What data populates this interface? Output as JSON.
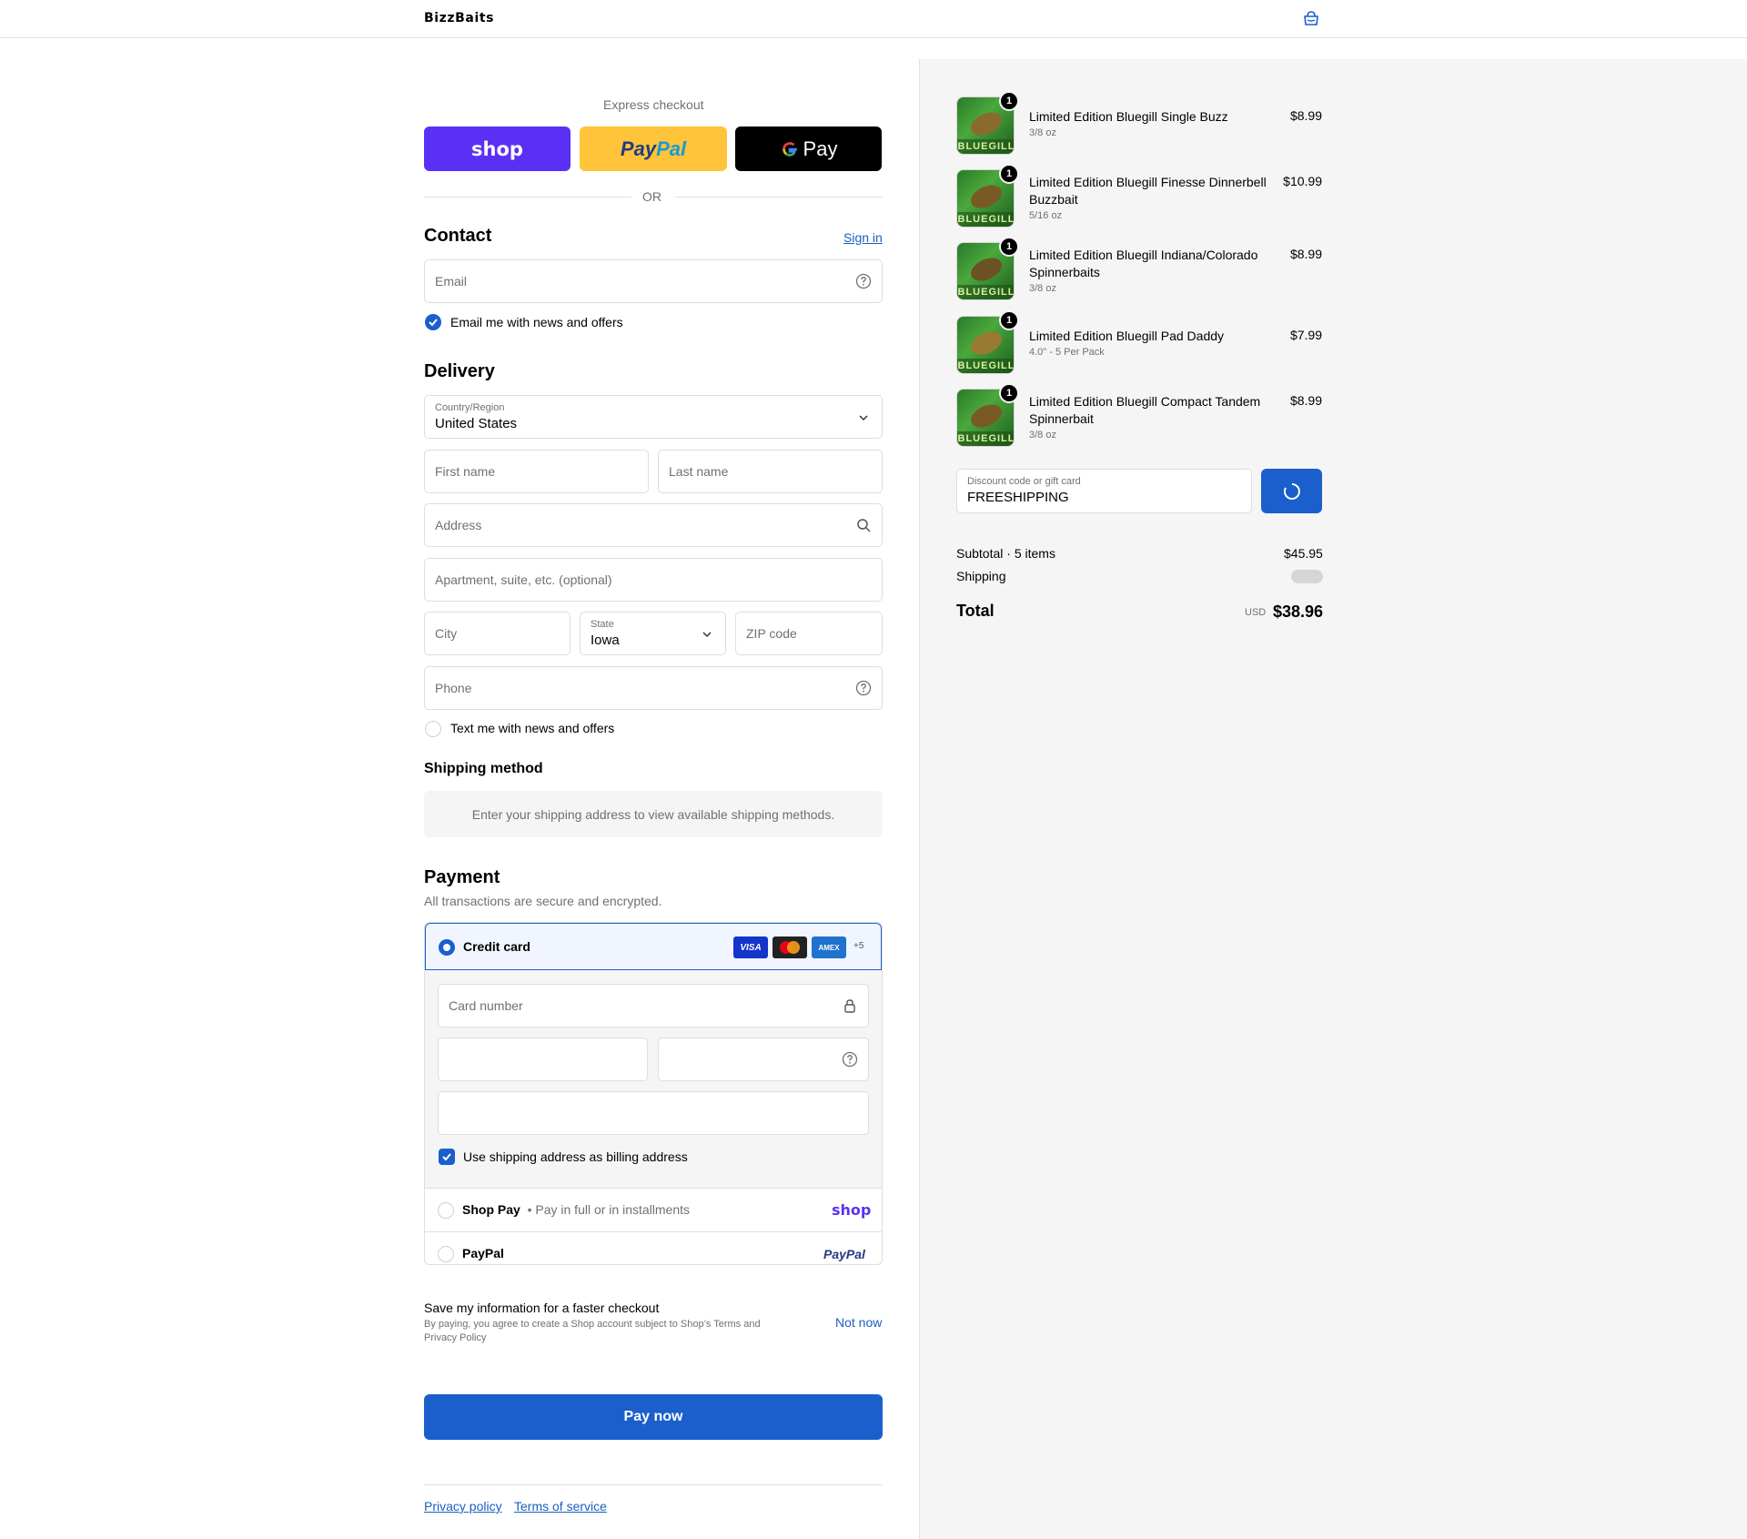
{
  "header": {
    "brand": "BizzBaits"
  },
  "express": {
    "label": "Express checkout",
    "shop_label": "shop",
    "paypal_pay": "Pay",
    "paypal_pal": "Pal",
    "gpay_label": "Pay",
    "or_label": "OR"
  },
  "contact": {
    "title": "Contact",
    "sign_in": "Sign in",
    "email_placeholder": "Email",
    "email_news": "Email me with news and offers"
  },
  "delivery": {
    "title": "Delivery",
    "country_label": "Country/Region",
    "country_value": "United States",
    "first_name": "First name",
    "last_name": "Last name",
    "address": "Address",
    "apartment": "Apartment, suite, etc. (optional)",
    "city": "City",
    "state_label": "State",
    "state_value": "Iowa",
    "zip": "ZIP code",
    "phone": "Phone",
    "text_news": "Text me with news and offers"
  },
  "shipping": {
    "title": "Shipping method",
    "notice": "Enter your shipping address to view available shipping methods."
  },
  "payment": {
    "title": "Payment",
    "subtitle": "All transactions are secure and encrypted.",
    "credit_card": "Credit card",
    "visa": "VISA",
    "amex": "AMEX",
    "more_cards": "+5",
    "card_number": "Card number",
    "billing_same": "Use shipping address as billing address",
    "shop_pay": "Shop Pay",
    "shop_pay_desc": "Pay in full or in installments",
    "shop_logo": "shop",
    "paypal": "PayPal",
    "paypal_logo": "PayPal"
  },
  "save_info": {
    "title": "Save my information for a faster checkout",
    "legal_prefix": "By paying, you agree to create a Shop account subject to Shop’s",
    "terms": "Terms",
    "and": "and",
    "privacy": "Privacy Policy",
    "not_now": "Not now"
  },
  "pay_now": "Pay now",
  "footer": {
    "privacy": "Privacy policy",
    "terms": "Terms of service"
  },
  "order": {
    "items": [
      {
        "qty": "1",
        "name": "Limited Edition Bluegill Single Buzz",
        "variant": "3/8 oz",
        "price": "$8.99",
        "thumb_text": "BLUEGILL"
      },
      {
        "qty": "1",
        "name": "Limited Edition Bluegill Finesse Dinnerbell Buzzbait",
        "variant": "5/16 oz",
        "price": "$10.99",
        "thumb_text": "BLUEGILL"
      },
      {
        "qty": "1",
        "name": "Limited Edition Bluegill Indiana/Colorado Spinnerbaits",
        "variant": "3/8 oz",
        "price": "$8.99",
        "thumb_text": "BLUEGILL"
      },
      {
        "qty": "1",
        "name": "Limited Edition Bluegill Pad Daddy",
        "variant": "4.0\" - 5 Per Pack",
        "price": "$7.99",
        "thumb_text": "BLUEGILL"
      },
      {
        "qty": "1",
        "name": "Limited Edition Bluegill Compact Tandem Spinnerbait",
        "variant": "3/8 oz",
        "price": "$8.99",
        "thumb_text": "BLUEGILL"
      }
    ],
    "discount_label": "Discount code or gift card",
    "discount_value": "FREESHIPPING",
    "subtotal_label": "Subtotal · 5 items",
    "subtotal_value": "$45.95",
    "shipping_label": "Shipping",
    "total_label": "Total",
    "currency": "USD",
    "total_value": "$38.96"
  },
  "colors": {
    "accent": "#1a5fcc",
    "shop_purple": "#5a31f4",
    "paypal_yellow": "#ffc439"
  }
}
